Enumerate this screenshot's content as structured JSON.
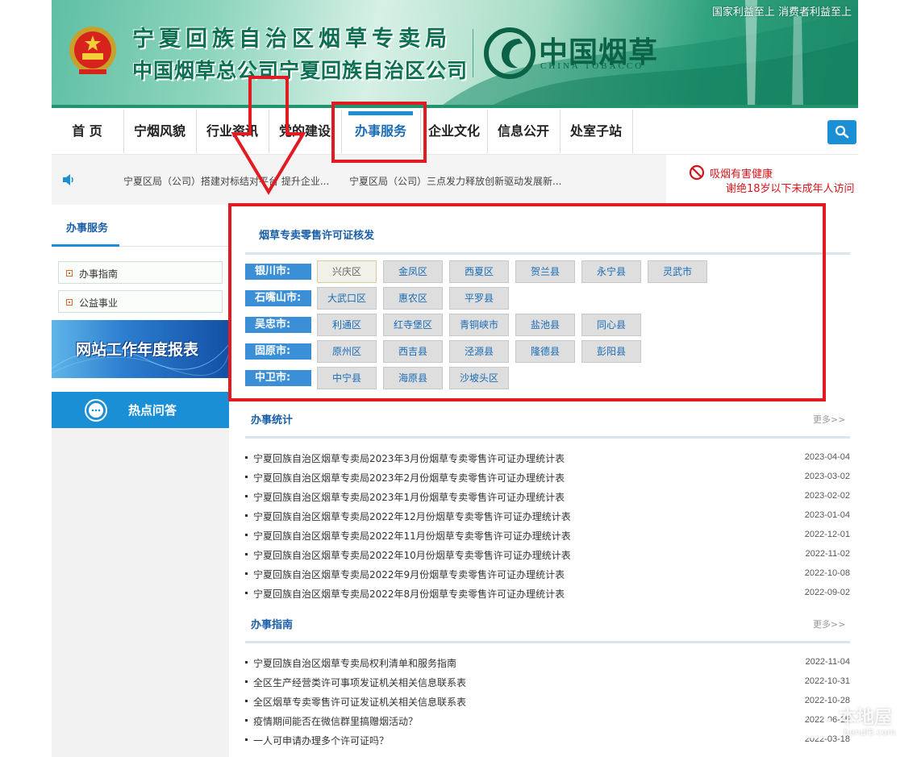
{
  "header": {
    "title_line_1": "宁夏回族自治区烟草专卖局",
    "title_line_2": "中国烟草总公司宁夏回族自治区公司",
    "brand_cn": "中国烟草",
    "brand_en": "CHINA TOBACCO",
    "slogan": "国家利益至上  消费者利益至上",
    "brand_color": "#0d6f52"
  },
  "nav": {
    "items": [
      "首 页",
      "宁烟风貌",
      "行业资讯",
      "党的建设",
      "办事服务",
      "企业文化",
      "信息公开",
      "处室子站"
    ],
    "active": "办事服务",
    "search_icon": "search-icon"
  },
  "notice": {
    "items": [
      "宁夏区局（公司）搭建对标结对平台  提升企业...",
      "宁夏区局（公司）三点发力释放创新驱动发展新..."
    ],
    "warning_line_1": "吸烟有害健康",
    "warning_line_2": "谢绝18岁以下未成年人访问",
    "warning_color": "#d4141b"
  },
  "sidebar": {
    "title": "办事服务",
    "links": [
      "办事指南",
      "公益事业"
    ],
    "banner": "网站工作年度报表",
    "hot": "热点问答"
  },
  "license": {
    "title": "烟草专卖零售许可证核发",
    "cities": [
      {
        "name": "银川市:",
        "districts": [
          "兴庆区",
          "金凤区",
          "西夏区",
          "贺兰县",
          "永宁县",
          "灵武市"
        ]
      },
      {
        "name": "石嘴山市:",
        "districts": [
          "大武口区",
          "惠农区",
          "平罗县"
        ]
      },
      {
        "name": "吴忠市:",
        "districts": [
          "利通区",
          "红寺堡区",
          "青铜峡市",
          "盐池县",
          "同心县"
        ]
      },
      {
        "name": "固原市:",
        "districts": [
          "原州区",
          "西吉县",
          "泾源县",
          "隆德县",
          "彭阳县"
        ]
      },
      {
        "name": "中卫市:",
        "districts": [
          "中宁县",
          "海原县",
          "沙坡头区"
        ]
      }
    ],
    "selected": "兴庆区"
  },
  "stats": {
    "title": "办事统计",
    "more": "更多>>",
    "rows": [
      {
        "text": "宁夏回族自治区烟草专卖局2023年3月份烟草专卖零售许可证办理统计表",
        "date": "2023-04-04"
      },
      {
        "text": "宁夏回族自治区烟草专卖局2023年2月份烟草专卖零售许可证办理统计表",
        "date": "2023-03-02"
      },
      {
        "text": "宁夏回族自治区烟草专卖局2023年1月份烟草专卖零售许可证办理统计表",
        "date": "2023-02-02"
      },
      {
        "text": "宁夏回族自治区烟草专卖局2022年12月份烟草专卖零售许可证办理统计表",
        "date": "2023-01-04"
      },
      {
        "text": "宁夏回族自治区烟草专卖局2022年11月份烟草专卖零售许可证办理统计表",
        "date": "2022-12-01"
      },
      {
        "text": "宁夏回族自治区烟草专卖局2022年10月份烟草专卖零售许可证办理统计表",
        "date": "2022-11-02"
      },
      {
        "text": "宁夏回族自治区烟草专卖局2022年9月份烟草专卖零售许可证办理统计表",
        "date": "2022-10-08"
      },
      {
        "text": "宁夏回族自治区烟草专卖局2022年8月份烟草专卖零售许可证办理统计表",
        "date": "2022-09-02"
      }
    ]
  },
  "guide": {
    "title": "办事指南",
    "more": "更多>>",
    "rows": [
      {
        "text": "宁夏回族自治区烟草专卖局权利清单和服务指南",
        "date": "2022-11-04"
      },
      {
        "text": "全区生产经营类许可事项发证机关相关信息联系表",
        "date": "2022-10-31"
      },
      {
        "text": "全区烟草专卖零售许可证发证机关相关信息联系表",
        "date": "2022-10-28"
      },
      {
        "text": "疫情期间能否在微信群里搞赠烟活动？",
        "date": "2022-06-15"
      },
      {
        "text": "一人可申请办理多个许可证吗？",
        "date": "2022-03-18"
      }
    ]
  },
  "watermark": {
    "cn": "本地屋",
    "en": "bendi5.com"
  }
}
